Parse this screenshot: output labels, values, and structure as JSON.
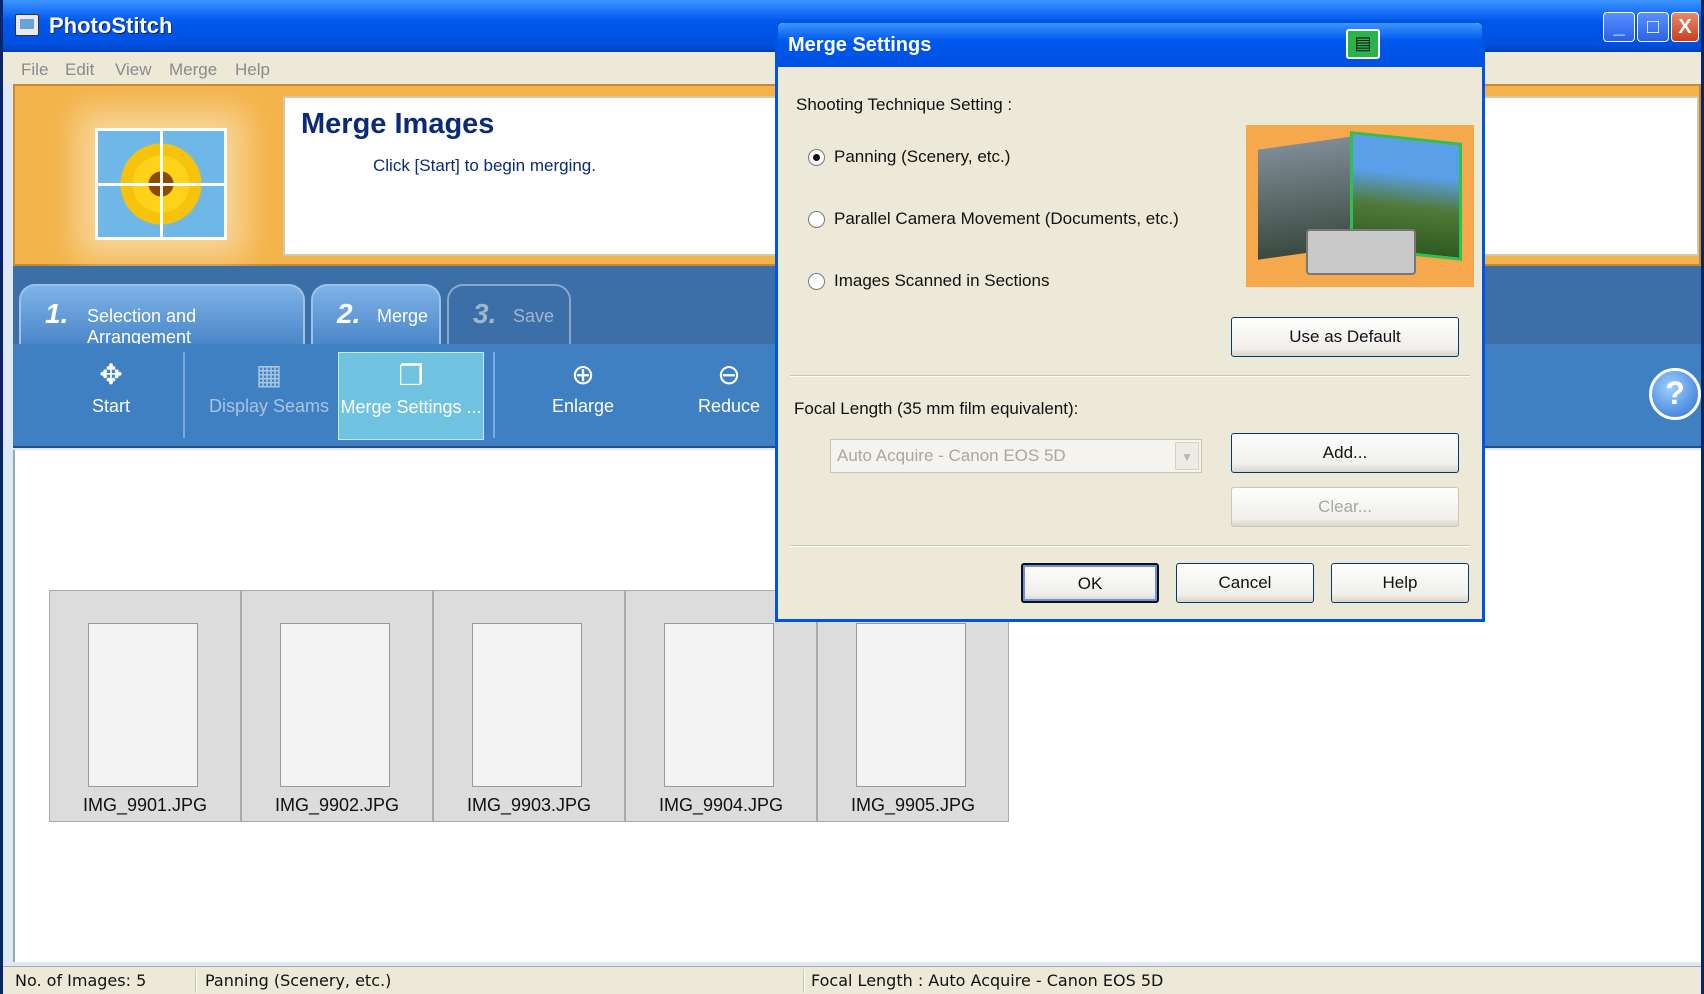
{
  "window": {
    "title": "PhotoStitch",
    "controls": [
      "_",
      "□",
      "X"
    ]
  },
  "menu": [
    "File",
    "Edit",
    "View",
    "Merge",
    "Help"
  ],
  "header": {
    "title": "Merge Images",
    "subtitle": "Click [Start] to begin merging."
  },
  "tabs": [
    {
      "num": "1.",
      "label": "Selection and Arrangement"
    },
    {
      "num": "2.",
      "label": "Merge"
    },
    {
      "num": "3.",
      "label": "Save"
    }
  ],
  "toolbar": {
    "start": "Start",
    "display_seams": "Display Seams",
    "merge_settings": "Merge Settings ...",
    "enlarge": "Enlarge",
    "reduce": "Reduce",
    "help_glyph": "?"
  },
  "thumbnails": [
    {
      "filename": "IMG_9901.JPG"
    },
    {
      "filename": "IMG_9902.JPG"
    },
    {
      "filename": "IMG_9903.JPG"
    },
    {
      "filename": "IMG_9904.JPG"
    },
    {
      "filename": "IMG_9905.JPG"
    }
  ],
  "status": {
    "count": "No. of Images: 5",
    "technique": "Panning (Scenery, etc.)",
    "focal": "Focal Length : Auto Acquire - Canon EOS 5D"
  },
  "dialog": {
    "title": "Merge Settings",
    "shooting_label": "Shooting Technique Setting :",
    "options": [
      {
        "label": "Panning (Scenery, etc.)",
        "selected": true
      },
      {
        "label": "Parallel Camera Movement (Documents, etc.)",
        "selected": false
      },
      {
        "label": "Images Scanned in Sections",
        "selected": false
      }
    ],
    "use_default": "Use as Default",
    "focal_label": "Focal Length (35 mm film equivalent):",
    "focal_value": "Auto Acquire - Canon EOS 5D",
    "add": "Add...",
    "clear": "Clear...",
    "ok": "OK",
    "cancel": "Cancel",
    "help": "Help"
  },
  "colors": {
    "titlebar": "#0058ee",
    "header_bg": "#f3b34a",
    "toolbar": "#3f80c3",
    "accent_dark": "#0a2a7a"
  }
}
